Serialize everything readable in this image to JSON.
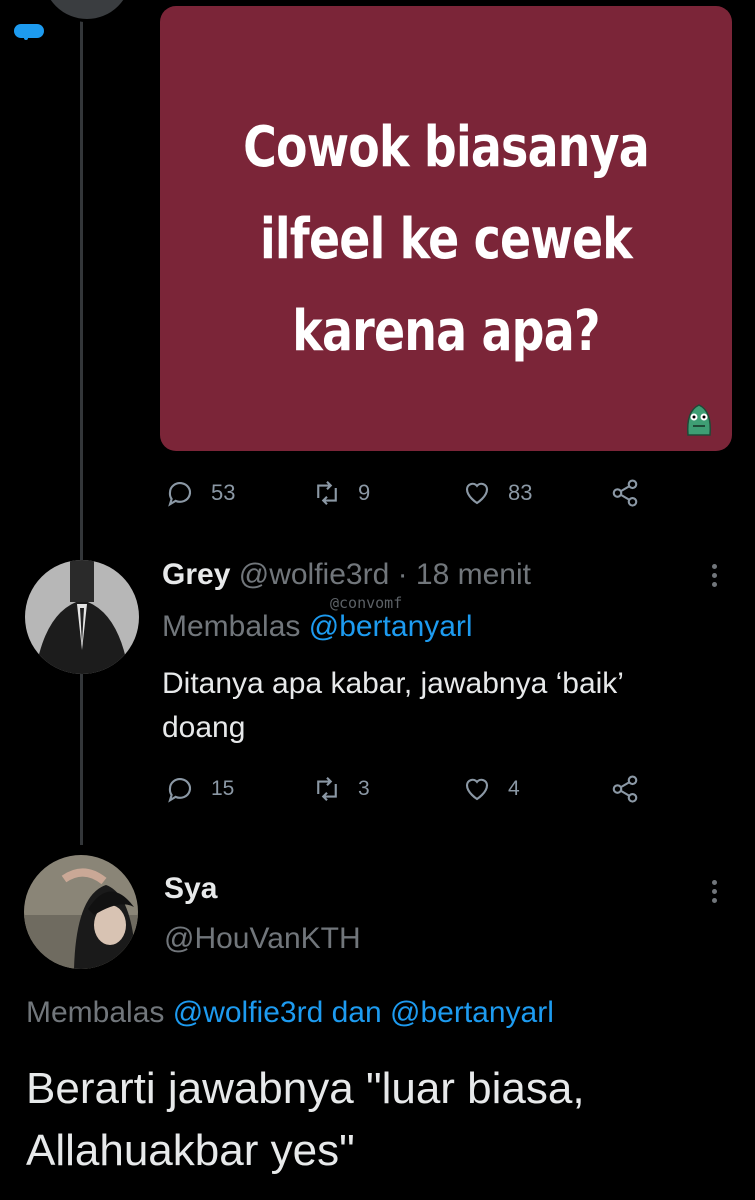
{
  "quoted_tweet": {
    "card_lines": [
      "Cowok biasanya",
      "ilfeel ke cewek",
      "karena apa?"
    ],
    "stats": {
      "replies": "53",
      "retweets": "9",
      "likes": "83"
    },
    "mini_badge_icon": "cloud-badge-icon",
    "mascot_icon": "monster-mascot-icon"
  },
  "reply1": {
    "name": "Grey",
    "handle": "@wolfie3rd",
    "time": "· 18 menit",
    "watermark": "@convomf",
    "replying_prefix": "Membalas",
    "replying_to": "@bertanyarl",
    "text_line1": "Ditanya apa kabar, jawabnya ‘baik’",
    "text_line2": "doang",
    "stats": {
      "replies": "15",
      "retweets": "3",
      "likes": "4"
    }
  },
  "reply2": {
    "name": "Sya",
    "handle": "@HouVanKTH",
    "replying_prefix": "Membalas",
    "replying_to1": "@wolfie3rd",
    "replying_join": "dan",
    "replying_to2": "@bertanyarl",
    "text_line1": "Berarti jawabnya \"luar biasa,",
    "text_line2": "Allahuakbar yes\""
  },
  "colors": {
    "background": "#000000",
    "card": "#7b2538",
    "link": "#1d9bf0",
    "muted": "#71767b",
    "text": "#e7e9ea"
  }
}
